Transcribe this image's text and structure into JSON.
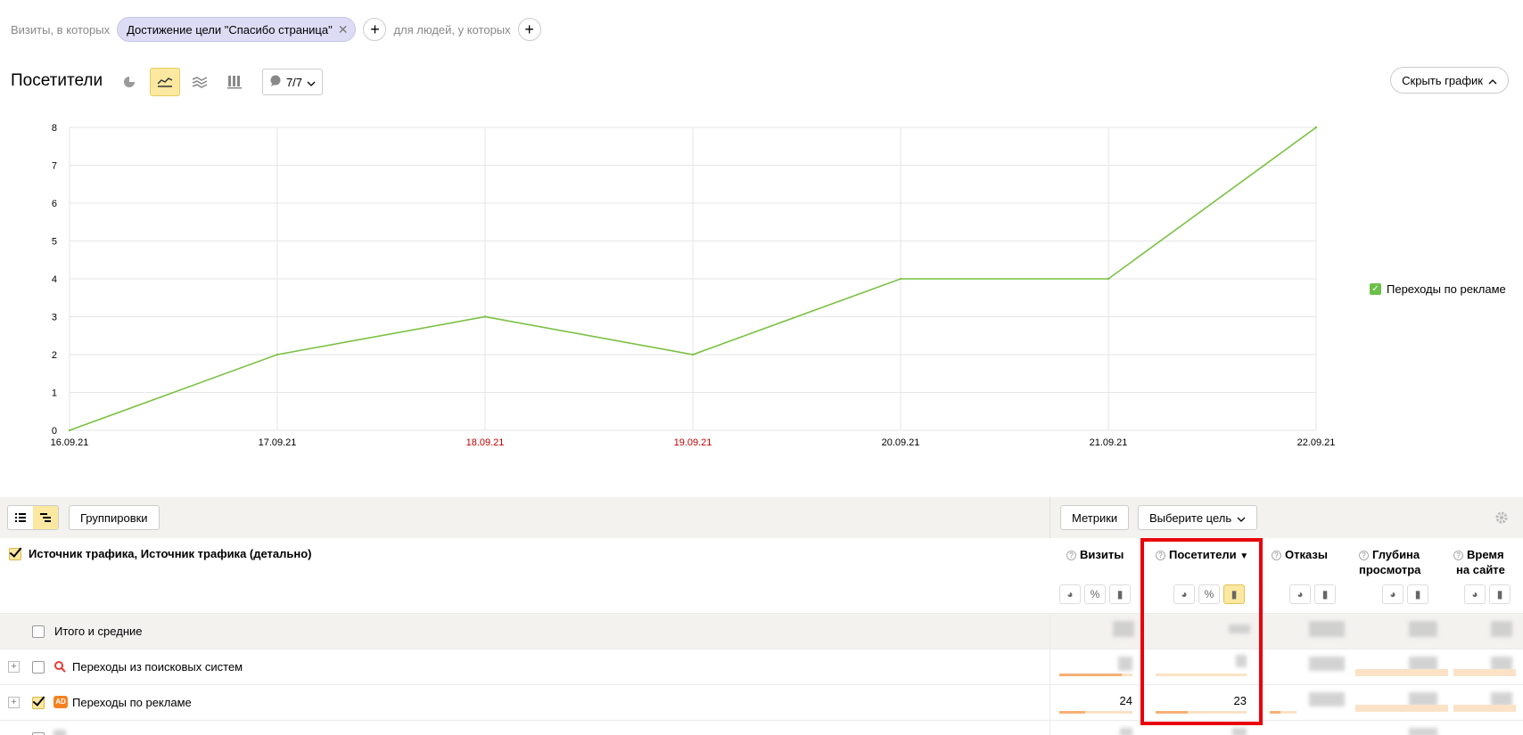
{
  "segments": {
    "prefix": "Визиты, в которых",
    "chip_label": "Достижение цели \"Спасибо страница\"",
    "people_label": "для людей, у которых"
  },
  "chart_header": {
    "title": "Посетители",
    "dropdown_label": "7/7",
    "hide_label": "Скрыть график"
  },
  "chart_data": {
    "type": "line",
    "x": [
      "16.09.21",
      "17.09.21",
      "18.09.21",
      "19.09.21",
      "20.09.21",
      "21.09.21",
      "22.09.21"
    ],
    "weekend_x": [
      "18.09.21",
      "19.09.21"
    ],
    "series": [
      {
        "name": "Переходы по рекламе",
        "values": [
          0,
          2,
          3,
          2,
          4,
          4,
          8
        ],
        "color": "#7ac143"
      }
    ],
    "yticks": [
      0,
      1,
      2,
      3,
      4,
      5,
      6,
      7,
      8
    ],
    "ylim": [
      0,
      8
    ],
    "grid": true,
    "legend": "right"
  },
  "toolbar": {
    "groupings_label": "Группировки",
    "metrics_label": "Метрики",
    "goal_label": "Выберите цель"
  },
  "table": {
    "dimension_header": "Источник трафика, Источник трафика (детально)",
    "columns": [
      "Визиты",
      "Посетители",
      "Отказы",
      "Глубина просмотра",
      "Время на сайте"
    ],
    "col_depth_line1": "Глубина",
    "col_depth_line2": "просмотра",
    "col_time_line1": "Время",
    "col_time_line2": "на сайте",
    "sort_indicator": "▼",
    "rows": [
      {
        "label": "Итого и средние"
      },
      {
        "label": "Переходы из поисковых систем"
      },
      {
        "label": "Переходы по рекламе",
        "visits": "24",
        "visitors": "23"
      }
    ]
  },
  "colors": {
    "line": "#7ac143",
    "weekend": "#c00000",
    "active": "#fce8a0",
    "highlight": "#e8000b"
  }
}
